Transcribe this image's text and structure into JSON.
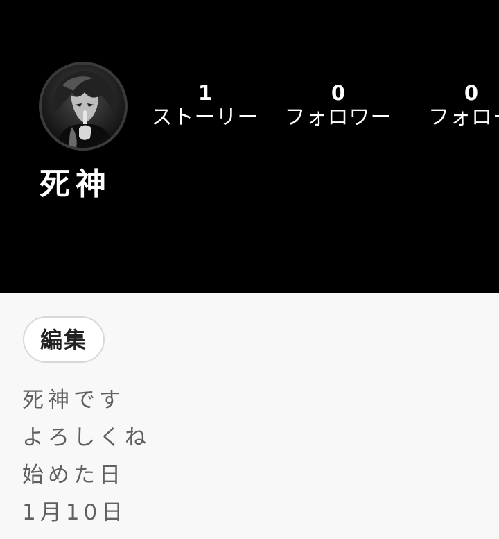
{
  "profile": {
    "display_name": "死神",
    "avatar_icon": "anime-character-avatar",
    "stats": {
      "stories": {
        "count": "1",
        "label": "ストーリー"
      },
      "followers": {
        "count": "0",
        "label": "フォロワー"
      },
      "following": {
        "count": "0",
        "label": "フォロー"
      }
    },
    "edit_label": "編集",
    "bio_lines": [
      "死神です",
      "よろしくね",
      "始めた日",
      "1月10日"
    ]
  },
  "colors": {
    "header_bg": "#000000",
    "page_bg": "#f8f8f8",
    "bio_text": "#606060"
  }
}
